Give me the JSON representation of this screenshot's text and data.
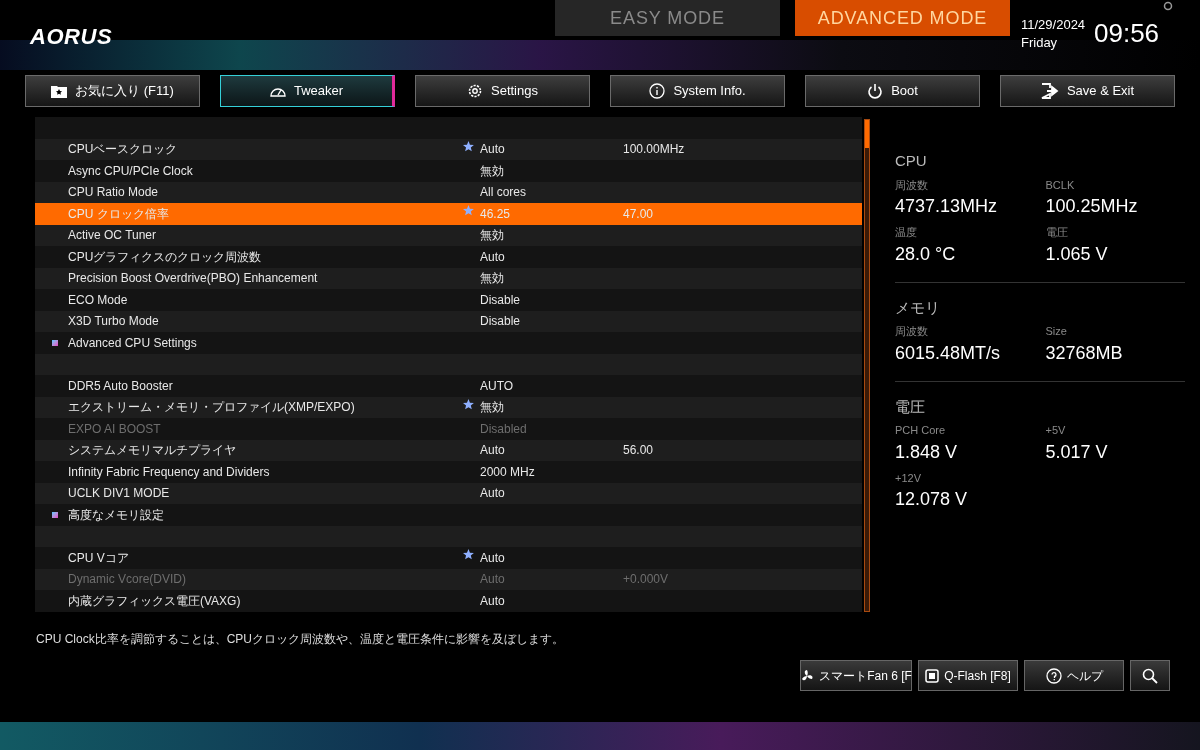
{
  "header": {
    "logo": "AORUS",
    "modes": [
      {
        "label": "EASY MODE",
        "selected": false
      },
      {
        "label": "ADVANCED MODE",
        "selected": true
      }
    ],
    "date": "11/29/2024",
    "weekday": "Friday",
    "time": "09:56"
  },
  "tabs": [
    {
      "label": "お気に入り (F11)",
      "selected": false
    },
    {
      "label": "Tweaker",
      "selected": true
    },
    {
      "label": "Settings",
      "selected": false
    },
    {
      "label": "System Info.",
      "selected": false
    },
    {
      "label": "Boot",
      "selected": false
    },
    {
      "label": "Save & Exit",
      "selected": false
    }
  ],
  "settings": [
    {
      "kind": "spacer"
    },
    {
      "kind": "item",
      "label": "CPUベースクロック",
      "value": "Auto",
      "value_2": "100.00MHz",
      "starred": true,
      "disabled": false,
      "selected": false
    },
    {
      "kind": "item",
      "label": "Async CPU/PCIe Clock",
      "value": "無効",
      "starred": false,
      "disabled": false,
      "selected": false
    },
    {
      "kind": "item",
      "label": "CPU Ratio Mode",
      "value": "All cores",
      "starred": false,
      "disabled": false,
      "selected": false
    },
    {
      "kind": "item",
      "label": "CPU クロック倍率",
      "value": "46.25",
      "value_2": "47.00",
      "starred": true,
      "disabled": false,
      "selected": true
    },
    {
      "kind": "item",
      "label": "Active OC Tuner",
      "value": "無効",
      "starred": false,
      "disabled": false,
      "selected": false
    },
    {
      "kind": "item",
      "label": "CPUグラフィクスのクロック周波数",
      "value": "Auto",
      "starred": false,
      "disabled": false,
      "selected": false
    },
    {
      "kind": "item",
      "label": "Precision Boost Overdrive(PBO) Enhancement",
      "value": "無効",
      "starred": false,
      "disabled": false,
      "selected": false
    },
    {
      "kind": "item",
      "label": "ECO Mode",
      "value": "Disable",
      "starred": false,
      "disabled": false,
      "selected": false
    },
    {
      "kind": "item",
      "label": "X3D Turbo Mode",
      "value": "Disable",
      "starred": false,
      "disabled": false,
      "selected": false
    },
    {
      "kind": "submenu",
      "label": "Advanced CPU Settings"
    },
    {
      "kind": "spacer"
    },
    {
      "kind": "item",
      "label": "DDR5 Auto Booster",
      "value": "AUTO",
      "starred": false,
      "disabled": false,
      "selected": false
    },
    {
      "kind": "item",
      "label": "エクストリーム・メモリ・プロファイル(XMP/EXPO)",
      "value": "無効",
      "starred": true,
      "disabled": false,
      "selected": false
    },
    {
      "kind": "item",
      "label": "EXPO AI BOOST",
      "value": "Disabled",
      "starred": false,
      "disabled": true,
      "selected": false
    },
    {
      "kind": "item",
      "label": "システムメモリマルチプライヤ",
      "value": "Auto",
      "value_2": "56.00",
      "starred": false,
      "disabled": false,
      "selected": false
    },
    {
      "kind": "item",
      "label": "Infinity Fabric Frequency and Dividers",
      "value": "2000 MHz",
      "starred": false,
      "disabled": false,
      "selected": false
    },
    {
      "kind": "item",
      "label": "UCLK DIV1 MODE",
      "value": "Auto",
      "starred": false,
      "disabled": false,
      "selected": false
    },
    {
      "kind": "submenu",
      "label": "高度なメモリ設定"
    },
    {
      "kind": "spacer"
    },
    {
      "kind": "item",
      "label": "CPU Vコア",
      "value": "Auto",
      "starred": true,
      "disabled": false,
      "selected": false
    },
    {
      "kind": "item",
      "label": "Dynamic Vcore(DVID)",
      "value": "Auto",
      "value_2": "+0.000V",
      "starred": false,
      "disabled": true,
      "selected": false
    },
    {
      "kind": "item",
      "label": "内蔵グラフィックス電圧(VAXG)",
      "value": "Auto",
      "starred": false,
      "disabled": false,
      "selected": false
    }
  ],
  "monitor": [
    {
      "title": "CPU",
      "readings": [
        {
          "label": "周波数",
          "value": "4737.13MHz"
        },
        {
          "label": "BCLK",
          "value": "100.25MHz"
        },
        {
          "label": "温度",
          "value": "28.0 °C"
        },
        {
          "label": "電圧",
          "value": "1.065 V"
        }
      ]
    },
    {
      "title": "メモリ",
      "readings": [
        {
          "label": "周波数",
          "value": "6015.48MT/s"
        },
        {
          "label": "Size",
          "value": "32768MB"
        }
      ]
    },
    {
      "title": "電圧",
      "readings": [
        {
          "label": "PCH Core",
          "value": "1.848 V"
        },
        {
          "label": "+5V",
          "value": "5.017 V"
        },
        {
          "label": "+12V",
          "value": "12.078 V"
        }
      ]
    }
  ],
  "help_text": "CPU Clock比率を調節することは、CPUクロック周波数や、温度と電圧条件に影響を及ぼします。",
  "bottom_buttons": [
    {
      "label": "スマートFan 6 [F"
    },
    {
      "label": "Q-Flash [F8]"
    },
    {
      "label": "ヘルプ"
    },
    {
      "kind": "search"
    }
  ]
}
